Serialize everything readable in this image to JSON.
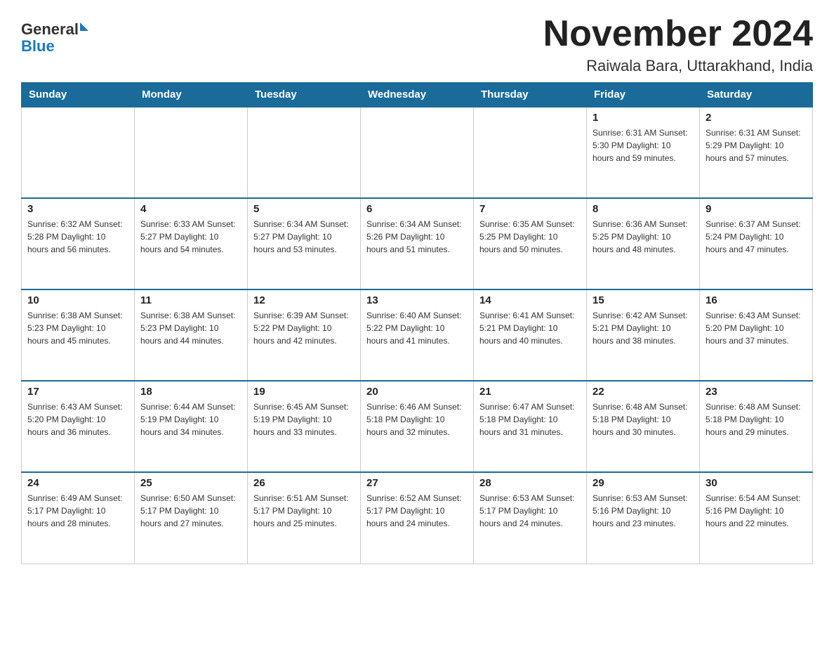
{
  "header": {
    "logo_general": "General",
    "logo_blue": "Blue",
    "month_title": "November 2024",
    "location": "Raiwala Bara, Uttarakhand, India"
  },
  "days_of_week": [
    "Sunday",
    "Monday",
    "Tuesday",
    "Wednesday",
    "Thursday",
    "Friday",
    "Saturday"
  ],
  "weeks": [
    [
      {
        "day": "",
        "info": ""
      },
      {
        "day": "",
        "info": ""
      },
      {
        "day": "",
        "info": ""
      },
      {
        "day": "",
        "info": ""
      },
      {
        "day": "",
        "info": ""
      },
      {
        "day": "1",
        "info": "Sunrise: 6:31 AM\nSunset: 5:30 PM\nDaylight: 10 hours and 59 minutes."
      },
      {
        "day": "2",
        "info": "Sunrise: 6:31 AM\nSunset: 5:29 PM\nDaylight: 10 hours and 57 minutes."
      }
    ],
    [
      {
        "day": "3",
        "info": "Sunrise: 6:32 AM\nSunset: 5:28 PM\nDaylight: 10 hours and 56 minutes."
      },
      {
        "day": "4",
        "info": "Sunrise: 6:33 AM\nSunset: 5:27 PM\nDaylight: 10 hours and 54 minutes."
      },
      {
        "day": "5",
        "info": "Sunrise: 6:34 AM\nSunset: 5:27 PM\nDaylight: 10 hours and 53 minutes."
      },
      {
        "day": "6",
        "info": "Sunrise: 6:34 AM\nSunset: 5:26 PM\nDaylight: 10 hours and 51 minutes."
      },
      {
        "day": "7",
        "info": "Sunrise: 6:35 AM\nSunset: 5:25 PM\nDaylight: 10 hours and 50 minutes."
      },
      {
        "day": "8",
        "info": "Sunrise: 6:36 AM\nSunset: 5:25 PM\nDaylight: 10 hours and 48 minutes."
      },
      {
        "day": "9",
        "info": "Sunrise: 6:37 AM\nSunset: 5:24 PM\nDaylight: 10 hours and 47 minutes."
      }
    ],
    [
      {
        "day": "10",
        "info": "Sunrise: 6:38 AM\nSunset: 5:23 PM\nDaylight: 10 hours and 45 minutes."
      },
      {
        "day": "11",
        "info": "Sunrise: 6:38 AM\nSunset: 5:23 PM\nDaylight: 10 hours and 44 minutes."
      },
      {
        "day": "12",
        "info": "Sunrise: 6:39 AM\nSunset: 5:22 PM\nDaylight: 10 hours and 42 minutes."
      },
      {
        "day": "13",
        "info": "Sunrise: 6:40 AM\nSunset: 5:22 PM\nDaylight: 10 hours and 41 minutes."
      },
      {
        "day": "14",
        "info": "Sunrise: 6:41 AM\nSunset: 5:21 PM\nDaylight: 10 hours and 40 minutes."
      },
      {
        "day": "15",
        "info": "Sunrise: 6:42 AM\nSunset: 5:21 PM\nDaylight: 10 hours and 38 minutes."
      },
      {
        "day": "16",
        "info": "Sunrise: 6:43 AM\nSunset: 5:20 PM\nDaylight: 10 hours and 37 minutes."
      }
    ],
    [
      {
        "day": "17",
        "info": "Sunrise: 6:43 AM\nSunset: 5:20 PM\nDaylight: 10 hours and 36 minutes."
      },
      {
        "day": "18",
        "info": "Sunrise: 6:44 AM\nSunset: 5:19 PM\nDaylight: 10 hours and 34 minutes."
      },
      {
        "day": "19",
        "info": "Sunrise: 6:45 AM\nSunset: 5:19 PM\nDaylight: 10 hours and 33 minutes."
      },
      {
        "day": "20",
        "info": "Sunrise: 6:46 AM\nSunset: 5:18 PM\nDaylight: 10 hours and 32 minutes."
      },
      {
        "day": "21",
        "info": "Sunrise: 6:47 AM\nSunset: 5:18 PM\nDaylight: 10 hours and 31 minutes."
      },
      {
        "day": "22",
        "info": "Sunrise: 6:48 AM\nSunset: 5:18 PM\nDaylight: 10 hours and 30 minutes."
      },
      {
        "day": "23",
        "info": "Sunrise: 6:48 AM\nSunset: 5:18 PM\nDaylight: 10 hours and 29 minutes."
      }
    ],
    [
      {
        "day": "24",
        "info": "Sunrise: 6:49 AM\nSunset: 5:17 PM\nDaylight: 10 hours and 28 minutes."
      },
      {
        "day": "25",
        "info": "Sunrise: 6:50 AM\nSunset: 5:17 PM\nDaylight: 10 hours and 27 minutes."
      },
      {
        "day": "26",
        "info": "Sunrise: 6:51 AM\nSunset: 5:17 PM\nDaylight: 10 hours and 25 minutes."
      },
      {
        "day": "27",
        "info": "Sunrise: 6:52 AM\nSunset: 5:17 PM\nDaylight: 10 hours and 24 minutes."
      },
      {
        "day": "28",
        "info": "Sunrise: 6:53 AM\nSunset: 5:17 PM\nDaylight: 10 hours and 24 minutes."
      },
      {
        "day": "29",
        "info": "Sunrise: 6:53 AM\nSunset: 5:16 PM\nDaylight: 10 hours and 23 minutes."
      },
      {
        "day": "30",
        "info": "Sunrise: 6:54 AM\nSunset: 5:16 PM\nDaylight: 10 hours and 22 minutes."
      }
    ]
  ]
}
